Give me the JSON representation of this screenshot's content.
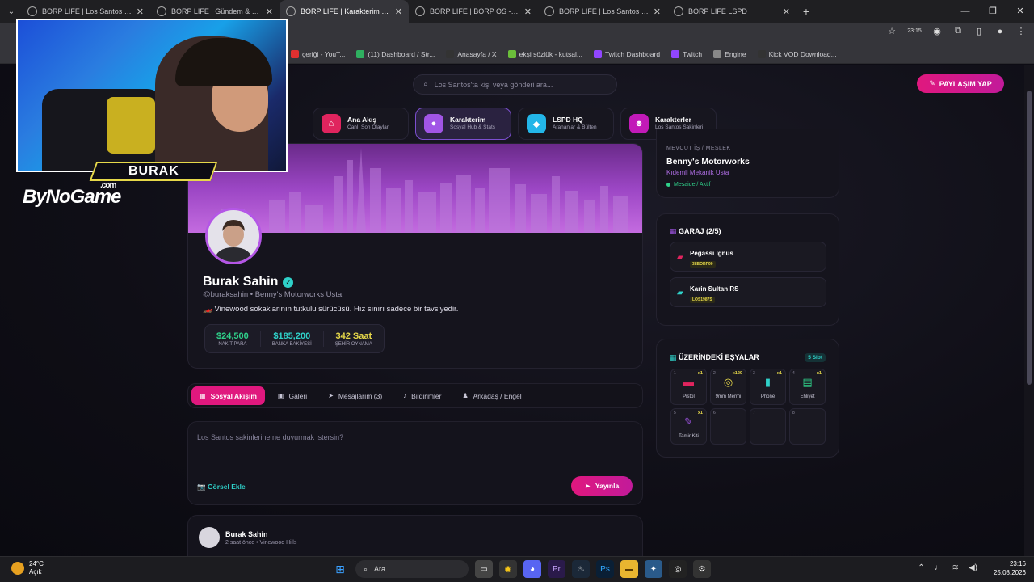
{
  "browser": {
    "tabs": [
      {
        "title": "BORP LIFE | Los Santos Social N",
        "active": false
      },
      {
        "title": "BORP LIFE | Gündem & Trendler",
        "active": false
      },
      {
        "title": "BORP LIFE | Karakterim & Sosya",
        "active": true
      },
      {
        "title": "BORP LIFE | BORP OS - Şehir Re",
        "active": false
      },
      {
        "title": "BORP LIFE | Los Santos Sakinleri",
        "active": false
      },
      {
        "title": "BORP LIFE LSPD",
        "active": false
      }
    ],
    "addr_time": "23:15",
    "bookmarks": [
      {
        "label": "çeriği - YouT...",
        "color": "#e03030"
      },
      {
        "label": "(11) Dashboard / Str...",
        "color": "#2fb060"
      },
      {
        "label": "Anasayfa / X",
        "color": "#333333"
      },
      {
        "label": "ekşi sözlük - kutsal...",
        "color": "#6bbf3a"
      },
      {
        "label": "Twitch Dashboard",
        "color": "#9146ff"
      },
      {
        "label": "Twitch",
        "color": "#9146ff"
      },
      {
        "label": "Engine",
        "color": "#888888"
      },
      {
        "label": "Kick VOD Download...",
        "color": "#333333"
      }
    ]
  },
  "header": {
    "search_placeholder": "Los Santos'ta kişi veya gönderi ara...",
    "share_label": "PAYLAŞIM YAP"
  },
  "nav": [
    {
      "title": "Ana Akış",
      "sub": "Canlı Son Olaylar",
      "color": "#e0245e",
      "icon": "⌂",
      "active": false
    },
    {
      "title": "Karakterim",
      "sub": "Sosyal Hub & Stats",
      "color": "#a155e6",
      "icon": "●",
      "active": true
    },
    {
      "title": "LSPD HQ",
      "sub": "Arananlar & Bülten",
      "color": "#23b6e8",
      "icon": "◆",
      "active": false
    },
    {
      "title": "Karakterler",
      "sub": "Los Santos Sakinleri",
      "color": "#c21ab8",
      "icon": "☻",
      "active": false
    }
  ],
  "profile": {
    "name": "Burak Sahin",
    "handle": "@buraksahin • Benny's Motorworks Usta",
    "bio": "🏎️ Vinewood sokaklarının tutkulu sürücüsü. Hız sınırı sadece bir tavsiyedir.",
    "stats": [
      {
        "value": "$24,500",
        "label": "NAKİT PARA",
        "color": "#2fd18a"
      },
      {
        "value": "$185,200",
        "label": "BANKA BAKİYESİ",
        "color": "#2fd1c9"
      },
      {
        "value": "342 Saat",
        "label": "ŞEHİR OYNAMA",
        "color": "#e6d84a"
      }
    ]
  },
  "feed_tabs": [
    {
      "label": "Sosyal Akışım",
      "icon": "▦",
      "active": true
    },
    {
      "label": "Galeri",
      "icon": "▣",
      "active": false
    },
    {
      "label": "Mesajlarım (3)",
      "icon": "➤",
      "active": false
    },
    {
      "label": "Bildirimler",
      "icon": "♪",
      "active": false
    },
    {
      "label": "Arkadaş / Engel",
      "icon": "♟",
      "active": false
    }
  ],
  "composer": {
    "placeholder": "Los Santos sakinlerine ne duyurmak istersin?",
    "add_image": "📷 Görsel Ekle",
    "publish": "Yayınla"
  },
  "post": {
    "author": "Burak Sahin",
    "meta": "2 saat önce • Vinewood Hills"
  },
  "job": {
    "label": "MEVCUT İŞ / MESLEK",
    "name": "Benny's Motorworks",
    "rank": "Kıdemli Mekanik Usta",
    "status": "Mesaide / Aktif"
  },
  "garage": {
    "title": "GARAJ (2/5)",
    "cars": [
      {
        "name": "Pegassi Ignus",
        "plate": "38BORP99",
        "color": "#e0245e"
      },
      {
        "name": "Karin Sultan RS",
        "plate": "LOS1987S",
        "color": "#2fd1c9"
      }
    ]
  },
  "inventory": {
    "title": "ÜZERİNDEKİ EŞYALAR",
    "slots_label": "5 Slot",
    "slots": [
      {
        "n": "1",
        "qty": "x1",
        "label": "Pistol",
        "icon": "▬",
        "color": "#e0245e"
      },
      {
        "n": "2",
        "qty": "x120",
        "label": "9mm Mermi",
        "icon": "◎",
        "color": "#e6d84a"
      },
      {
        "n": "3",
        "qty": "x1",
        "label": "Phone",
        "icon": "▮",
        "color": "#2fd1c9"
      },
      {
        "n": "4",
        "qty": "x1",
        "label": "Ehliyet",
        "icon": "▤",
        "color": "#2fd18a"
      },
      {
        "n": "5",
        "qty": "x1",
        "label": "Tamir Kiti",
        "icon": "✎",
        "color": "#a155e6"
      },
      {
        "n": "6",
        "qty": "",
        "label": "",
        "icon": "",
        "color": "#ffffff"
      },
      {
        "n": "7",
        "qty": "",
        "label": "",
        "icon": "",
        "color": "#ffffff"
      },
      {
        "n": "8",
        "qty": "",
        "label": "",
        "icon": "",
        "color": "#ffffff"
      }
    ]
  },
  "overlay": {
    "streamer": "BURAK",
    "brand": "ByNoGame",
    "brand_suffix": ".com"
  },
  "taskbar": {
    "temp": "24°C",
    "weather": "Açık",
    "search": "Ara",
    "time": "23:16",
    "date": "25.08.2026"
  }
}
